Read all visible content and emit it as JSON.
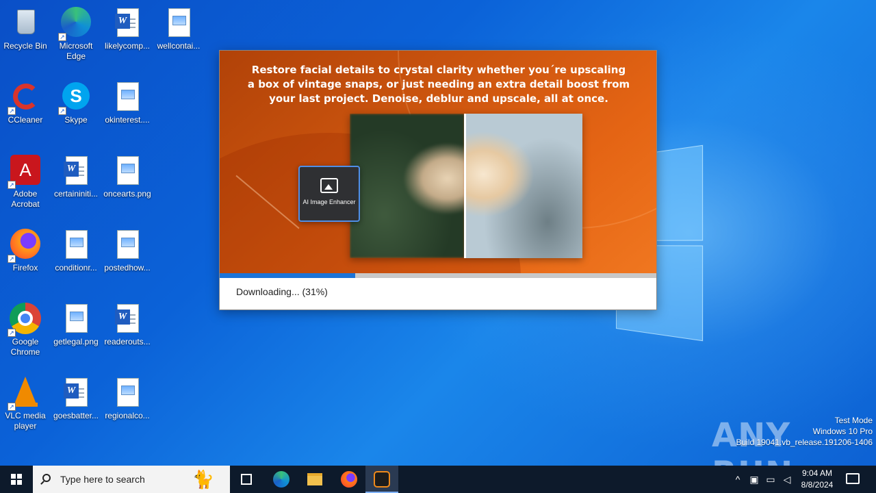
{
  "desktop": {
    "icons": [
      {
        "label": "Recycle Bin",
        "icon": "recycle-bin-icon"
      },
      {
        "label": "Microsoft Edge",
        "icon": "edge-icon"
      },
      {
        "label": "likelycomp...",
        "icon": "word-doc-icon"
      },
      {
        "label": "wellcontai...",
        "icon": "image-file-icon"
      },
      {
        "label": "CCleaner",
        "icon": "ccleaner-icon"
      },
      {
        "label": "Skype",
        "icon": "skype-icon"
      },
      {
        "label": "okinterest....",
        "icon": "image-file-icon"
      },
      {
        "label": "Adobe Acrobat",
        "icon": "acrobat-icon"
      },
      {
        "label": "certaininiti...",
        "icon": "word-doc-icon"
      },
      {
        "label": "oncearts.png",
        "icon": "image-file-icon"
      },
      {
        "label": "Firefox",
        "icon": "firefox-icon"
      },
      {
        "label": "conditionr...",
        "icon": "image-file-icon"
      },
      {
        "label": "postedhow...",
        "icon": "image-file-icon"
      },
      {
        "label": "Google Chrome",
        "icon": "chrome-icon"
      },
      {
        "label": "getlegal.png",
        "icon": "image-file-icon"
      },
      {
        "label": "readerouts...",
        "icon": "word-doc-icon"
      },
      {
        "label": "VLC media player",
        "icon": "vlc-icon"
      },
      {
        "label": "goesbatter...",
        "icon": "word-doc-icon"
      },
      {
        "label": "regionalco...",
        "icon": "image-file-icon"
      }
    ]
  },
  "installer": {
    "headline": "Restore facial details to crystal clarity whether you´re upscaling a box of vintage snaps, or just needing an extra detail boost from your last project. Denoise, deblur and upscale, all at once.",
    "ai_card_label": "AI Image Enhancer",
    "status": "Downloading... (31%)",
    "progress_fraction": 0.31,
    "accent_color": "#1c74d8",
    "banner_color": "#d9590f"
  },
  "watermark": {
    "brand": "ANY RUN",
    "line1": "Test Mode",
    "line2": "Windows 10 Pro",
    "line3": "Build 19041.vb_release.191206-1406"
  },
  "taskbar": {
    "search_placeholder": "Type here to search",
    "pinned": [
      "task-view-icon",
      "edge-icon",
      "file-explorer-icon",
      "firefox-icon",
      "installer-app-icon"
    ],
    "time": "9:04 AM",
    "date": "8/8/2024",
    "tray_icons": [
      "chevron-up-icon",
      "meet-now-icon",
      "network-icon",
      "volume-icon",
      "notifications-icon"
    ]
  }
}
